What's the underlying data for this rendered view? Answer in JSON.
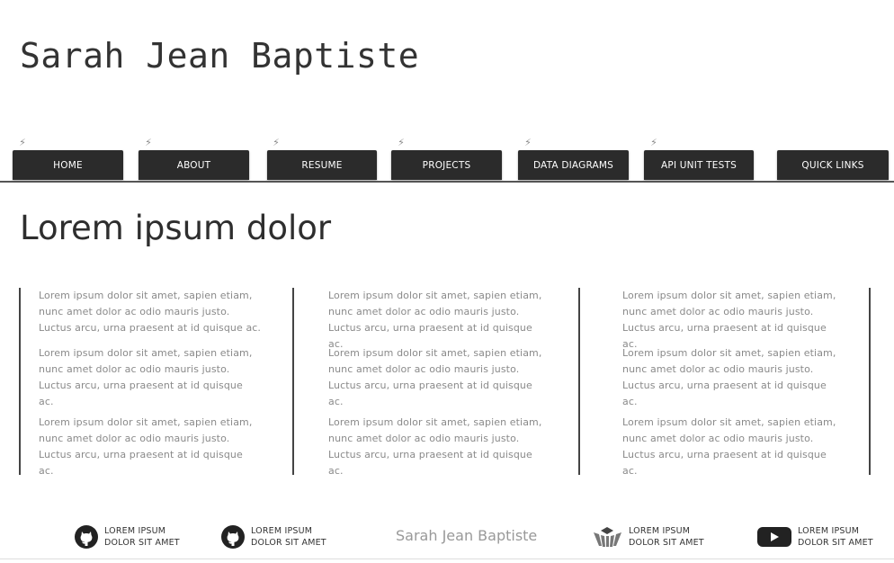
{
  "header": {
    "title": "Sarah Jean Baptiste"
  },
  "nav": {
    "items": [
      {
        "label": "HOME"
      },
      {
        "label": "ABOUT"
      },
      {
        "label": "RESUME"
      },
      {
        "label": "PROJECTS"
      },
      {
        "label": "DATA DIAGRAMS"
      },
      {
        "label": "API UNIT TESTS"
      },
      {
        "label": "QUICK LINKS"
      }
    ],
    "icon": "lightning-bolt-icon"
  },
  "main": {
    "heading": "Lorem ipsum dolor",
    "columns": [
      {
        "paragraphs": [
          "Lorem ipsum dolor sit amet, sapien etiam, nunc amet dolor ac odio mauris justo. Luctus arcu, urna praesent at id quisque ac.",
          "Lorem ipsum dolor sit amet, sapien etiam, nunc amet dolor ac odio mauris justo. Luctus arcu, urna praesent at id quisque ac.",
          "Lorem ipsum dolor sit amet, sapien etiam, nunc amet dolor ac odio mauris justo. Luctus arcu, urna praesent at id quisque ac."
        ]
      },
      {
        "paragraphs": [
          "Lorem ipsum dolor sit amet, sapien etiam, nunc amet dolor ac odio mauris justo. Luctus arcu, urna praesent at id quisque ac.",
          "Lorem ipsum dolor sit amet, sapien etiam, nunc amet dolor ac odio mauris justo. Luctus arcu, urna praesent at id quisque ac.",
          "Lorem ipsum dolor sit amet, sapien etiam, nunc amet dolor ac odio mauris justo. Luctus arcu, urna praesent at id quisque ac."
        ]
      },
      {
        "paragraphs": [
          "Lorem ipsum dolor sit amet, sapien etiam, nunc amet dolor ac odio mauris justo. Luctus arcu, urna praesent at id quisque ac.",
          "Lorem ipsum dolor sit amet, sapien etiam, nunc amet dolor ac odio mauris justo. Luctus arcu, urna praesent at id quisque ac.",
          "Lorem ipsum dolor sit amet, sapien etiam, nunc amet dolor ac odio mauris justo. Luctus arcu, urna praesent at id quisque ac."
        ]
      }
    ]
  },
  "footer": {
    "name": "Sarah Jean Baptiste",
    "links": [
      {
        "icon": "github-icon",
        "line1": "LOREM IPSUM",
        "line2": "DOLOR SIT AMET"
      },
      {
        "icon": "github-icon",
        "line1": "LOREM IPSUM",
        "line2": "DOLOR SIT AMET"
      },
      {
        "icon": "stack-overflow-icon",
        "line1": "LOREM IPSUM",
        "line2": "DOLOR SIT AMET"
      },
      {
        "icon": "youtube-icon",
        "line1": "LOREM IPSUM",
        "line2": "DOLOR SIT AMET"
      }
    ]
  },
  "colors": {
    "nav_bg": "#2b2b2b",
    "text": "#333333",
    "muted": "#8a8a8a"
  }
}
